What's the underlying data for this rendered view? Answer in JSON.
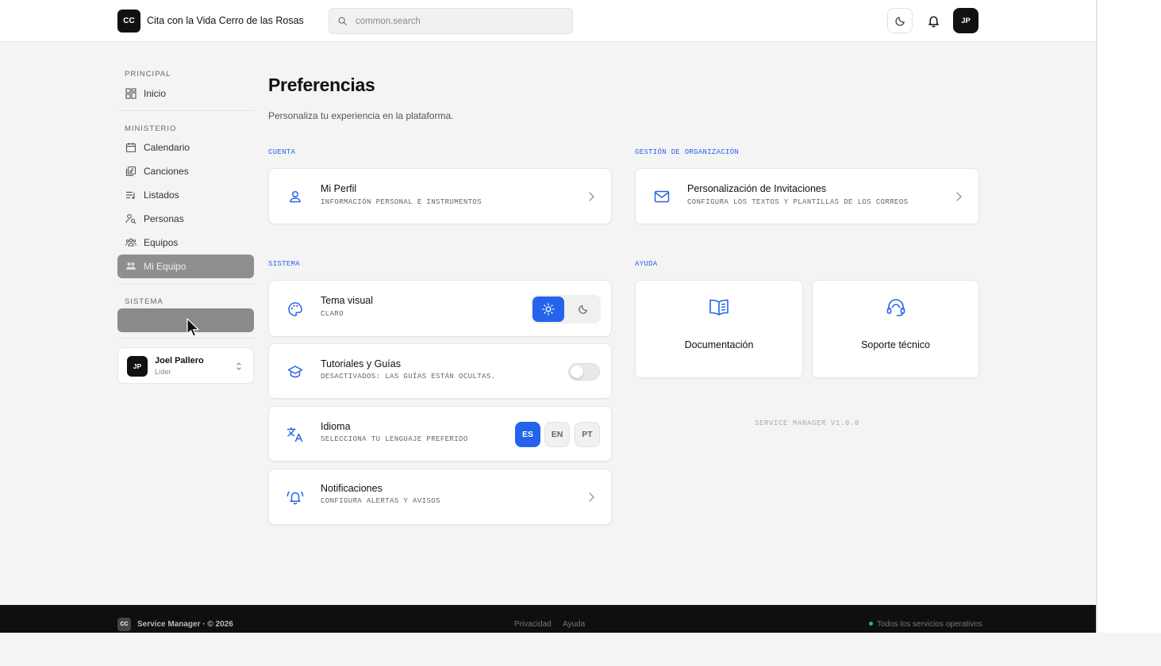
{
  "header": {
    "logo_text": "CC",
    "org_name": "Cita con la Vida Cerro de las Rosas",
    "search_placeholder": "common.search",
    "avatar_initials": "JP"
  },
  "sidebar": {
    "sections": [
      {
        "label": "PRINCIPAL",
        "items": [
          {
            "label": "Inicio",
            "icon": "dashboard-icon"
          }
        ]
      },
      {
        "label": "MINISTERIO",
        "items": [
          {
            "label": "Calendario",
            "icon": "calendar-icon"
          },
          {
            "label": "Canciones",
            "icon": "music-library-icon"
          },
          {
            "label": "Listados",
            "icon": "list-music-icon"
          },
          {
            "label": "Personas",
            "icon": "user-search-icon"
          },
          {
            "label": "Equipos",
            "icon": "team-icon"
          },
          {
            "label": "Mi Equipo",
            "icon": "my-team-icon"
          }
        ]
      },
      {
        "label": "SISTEMA",
        "items": []
      }
    ],
    "user": {
      "initials": "JP",
      "name": "Joel Pallero",
      "role": "Líder"
    }
  },
  "main": {
    "title": "Preferencias",
    "subtitle": "Personaliza tu experiencia en la plataforma.",
    "groups": {
      "cuenta": "CUENTA",
      "gestion": "GESTIÓN DE ORGANIZACIÓN",
      "sistema": "SISTEMA",
      "ayuda": "AYUDA"
    },
    "cards": {
      "perfil": {
        "title": "Mi Perfil",
        "desc": "INFORMACIÓN PERSONAL E INSTRUMENTOS"
      },
      "invitaciones": {
        "title": "Personalización de Invitaciones",
        "desc": "CONFIGURA LOS TEXTOS Y PLANTILLAS DE LOS CORREOS"
      },
      "tema": {
        "title": "Tema visual",
        "desc": "CLARO",
        "selected": "light"
      },
      "tutoriales": {
        "title": "Tutoriales y Guías",
        "desc": "DESACTIVADOS: LAS GUÍAS ESTÁN OCULTAS.",
        "enabled": false
      },
      "idioma": {
        "title": "Idioma",
        "desc": "SELECCIONA TU LENGUAJE PREFERIDO",
        "options": [
          "ES",
          "EN",
          "PT"
        ],
        "selected": "ES"
      },
      "notificaciones": {
        "title": "Notificaciones",
        "desc": "CONFIGURA ALERTAS Y AVISOS"
      }
    },
    "help": {
      "docs": "Documentación",
      "support": "Soporte técnico"
    },
    "version": "SERVICE MANAGER V1.0.0"
  },
  "footer": {
    "logo_text": "CC",
    "brand": "Service Manager · © 2026",
    "links": [
      "Privacidad",
      "Ayuda"
    ],
    "status": "Todos los servicios operativos"
  },
  "colors": {
    "accent": "#2563eb",
    "status_ok": "#22c55e",
    "dark": "#111111"
  }
}
